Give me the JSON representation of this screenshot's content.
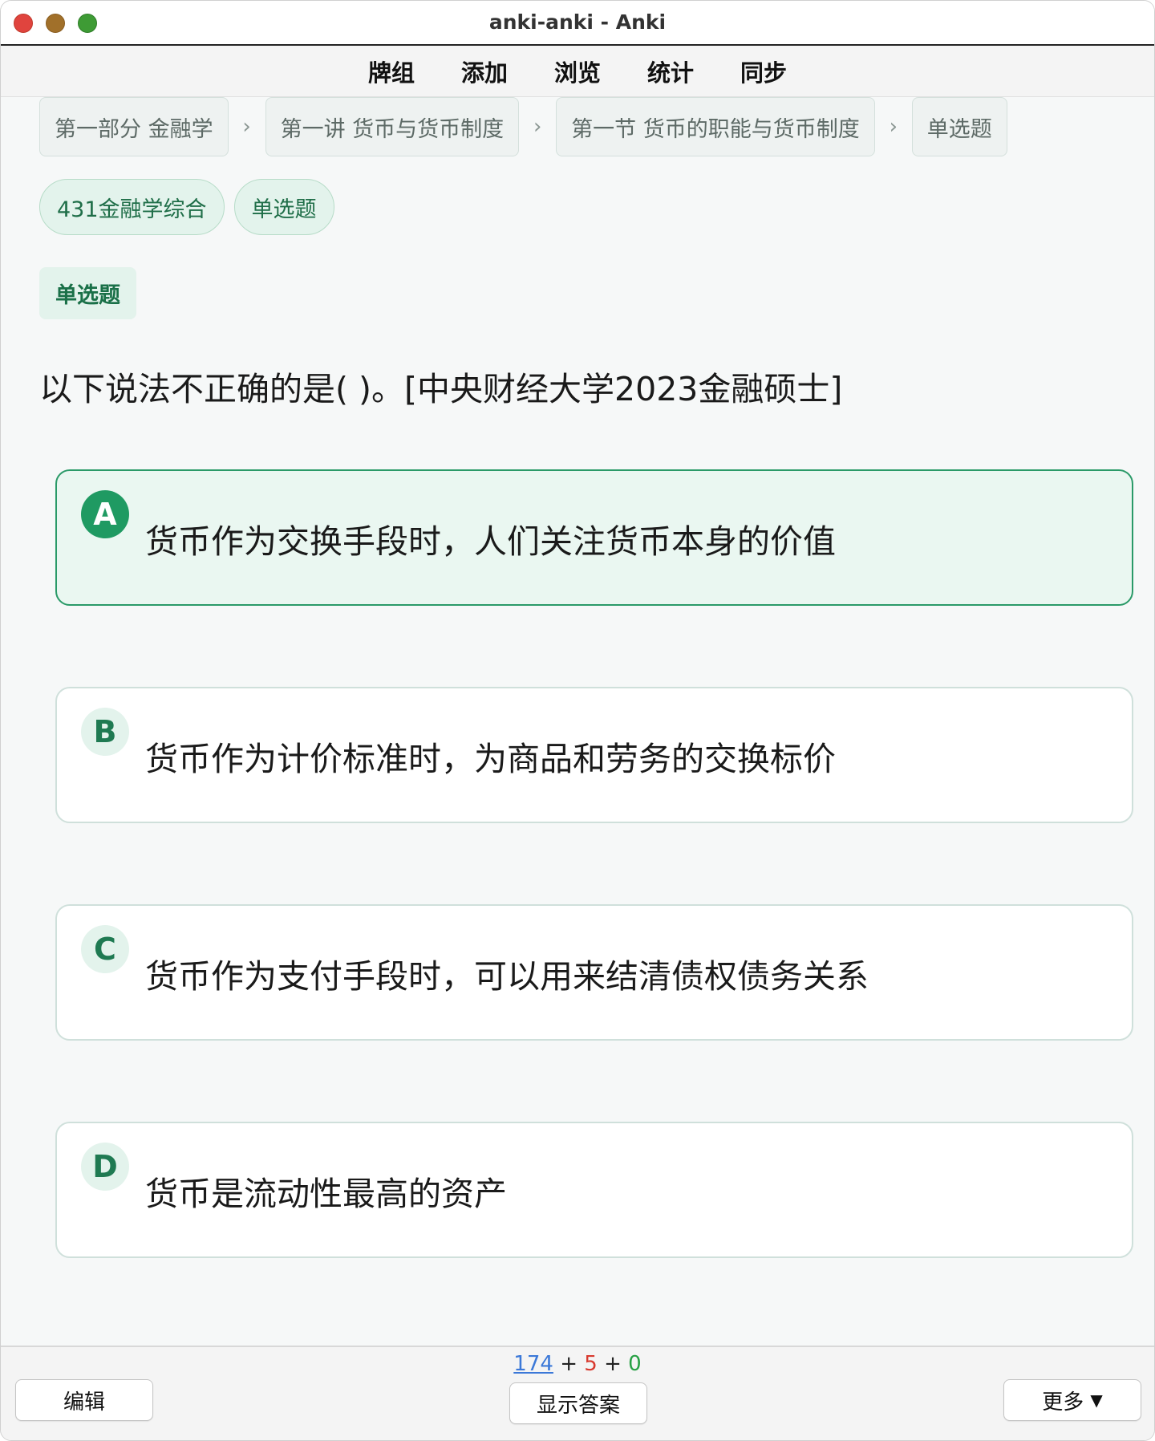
{
  "window": {
    "title": "anki-anki - Anki"
  },
  "topmenu": {
    "items": [
      "牌组",
      "添加",
      "浏览",
      "统计",
      "同步"
    ]
  },
  "breadcrumb": {
    "items": [
      "第一部分 金融学",
      "第一讲 货币与货币制度",
      "第一节 货币的职能与货币制度",
      "单选题"
    ],
    "separator": "›"
  },
  "tags": [
    "431金融学综合",
    "单选题"
  ],
  "card": {
    "type_label": "单选题",
    "question": "以下说法不正确的是( )。[中央财经大学2023金融硕士]",
    "options": [
      {
        "letter": "A",
        "text": "货币作为交换手段时，人们关注货币本身的价值",
        "selected": true
      },
      {
        "letter": "B",
        "text": "货币作为计价标准时，为商品和劳务的交换标价",
        "selected": false
      },
      {
        "letter": "C",
        "text": "货币作为支付手段时，可以用来结清债权债务关系",
        "selected": false
      },
      {
        "letter": "D",
        "text": "货币是流动性最高的资产",
        "selected": false
      }
    ]
  },
  "bottombar": {
    "edit_label": "编辑",
    "show_answer_label": "显示答案",
    "more_label": "更多",
    "counts": {
      "new": "174",
      "learn": "5",
      "review": "0",
      "plus": "+"
    }
  },
  "colors": {
    "accent": "#1f9a62",
    "new_count": "#3b78d8",
    "learn_count": "#d83a2f",
    "review_count": "#27a044"
  }
}
